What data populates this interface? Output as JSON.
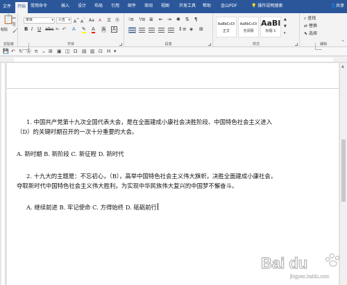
{
  "tabs": {
    "file": "文件",
    "items": [
      "开始",
      "常用命令",
      "插入",
      "设计",
      "布局",
      "引用",
      "邮件",
      "审阅",
      "视图",
      "开发工具",
      "帮助",
      "金山PDF"
    ],
    "active_index": 0,
    "tell_me": "操作说明搜索",
    "share": "共享"
  },
  "ribbon": {
    "clipboard": {
      "paste": "粘贴",
      "label": "剪贴板"
    },
    "font": {
      "name": "宋体",
      "size": "小五",
      "label": "字体"
    },
    "paragraph": {
      "label": "段落"
    },
    "styles": {
      "label": "样式",
      "items": [
        {
          "preview": "AaBbCcDi",
          "name": "正文"
        },
        {
          "preview": "AaBbCcDi",
          "name": "无间隔"
        },
        {
          "preview": "AaBl",
          "name": "标题 1"
        }
      ]
    },
    "editing": {
      "find": "查找",
      "replace": "替换",
      "select": "选择",
      "label": "编辑"
    }
  },
  "document": {
    "lines": [
      "1.  中国共产党第十九次全国代表大会，是在全面建成小康社会决胜阶段、中国特色社会主义进入",
      "（D）的关键时期召开的一次十分重要的大会。",
      "A. 新时期   B. 新阶段   C. 新征程   D. 新时代",
      "2.  十九大的主题是：不忘初心，（B），高举中国特色社会主义伟大旗帜，决胜全面建成小康社会，",
      "夺取新时代中国特色社会主义伟大胜利，为实现中华民族伟大复兴的中国梦不懈奋斗。",
      "A. 继续前进   B. 牢记使命   C. 方得始终   D. 砥砺前行"
    ]
  },
  "watermark": {
    "brand": "Bai du",
    "sub": "jingyan.baidu.com"
  },
  "colors": {
    "tabbar": "#2b579a",
    "ribbon": "#f3f3f3",
    "page": "#ffffff"
  }
}
